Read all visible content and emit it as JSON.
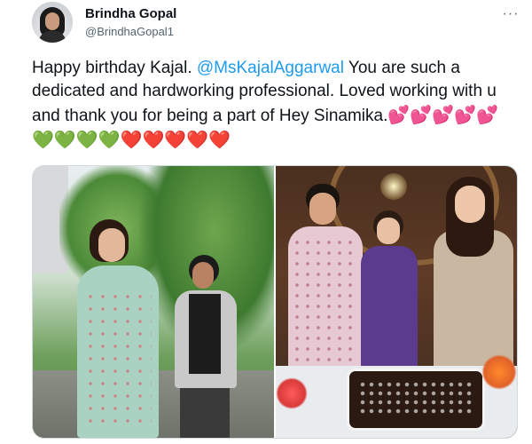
{
  "tweet": {
    "author_name": "Brindha Gopal",
    "author_handle": "@BrindhaGopal1",
    "more_label": "···",
    "text_prefix": "Happy birthday Kajal. ",
    "mention": "@MsKajalAggarwal",
    "text_suffix": " You are such a dedicated and hardworking  professional. Loved working with u and thank you for being a part of Hey Sinamika.",
    "emoji_sequence": "💕💕💕💕💕💚💚💚💚❤️❤️❤️❤️❤️"
  },
  "media": {
    "images": [
      {
        "icon": "photo-woman-garden"
      },
      {
        "icon": "photo-birthday-cake-party"
      }
    ]
  },
  "colors": {
    "accent": "#1d9bf0",
    "text": "#0f1419",
    "secondary_text": "#536471",
    "border": "#cfd9de"
  }
}
